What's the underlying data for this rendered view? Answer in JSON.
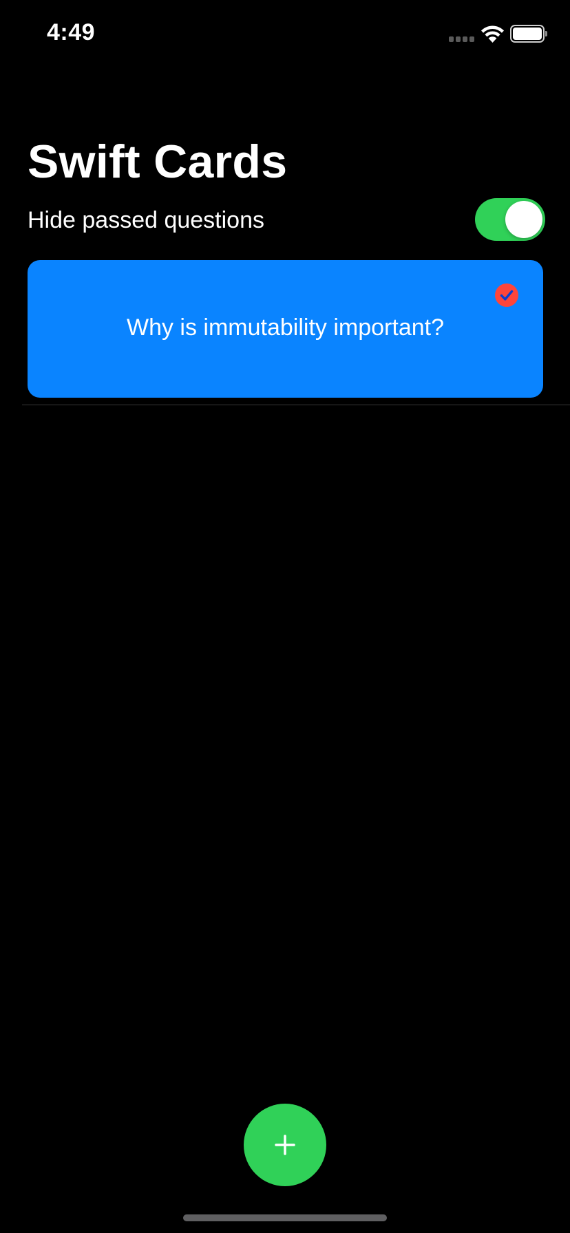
{
  "status_bar": {
    "time": "4:49",
    "icons": [
      "signal-icon",
      "wifi-icon",
      "battery-icon"
    ]
  },
  "header": {
    "title": "Swift Cards"
  },
  "filter": {
    "label": "Hide passed questions",
    "enabled": true
  },
  "cards": [
    {
      "question": "Why is immutability important?",
      "passed": true,
      "icon": "checkmark-circle-icon"
    }
  ],
  "actions": {
    "add_icon": "plus-icon"
  },
  "colors": {
    "background": "#000000",
    "card": "#0a84ff",
    "toggle_on": "#30d158",
    "add_button": "#30d158",
    "passed_badge": "#ff453a"
  }
}
